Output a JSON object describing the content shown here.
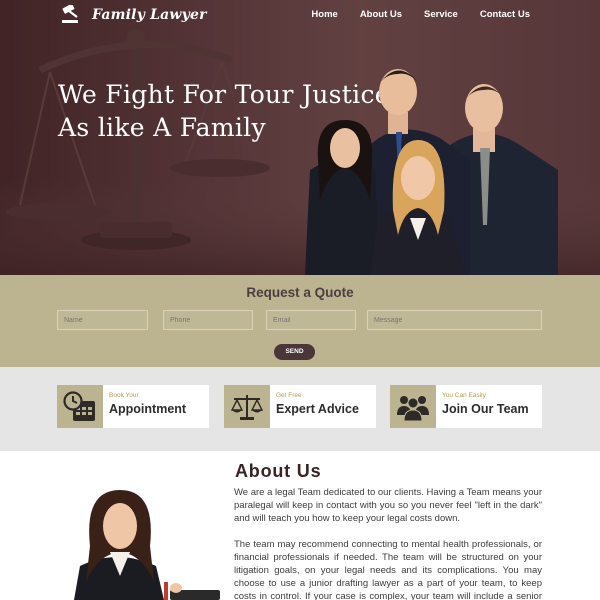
{
  "brand": {
    "name": "Family Lawyer"
  },
  "nav": {
    "items": [
      {
        "label": "Home"
      },
      {
        "label": "About Us"
      },
      {
        "label": "Service"
      },
      {
        "label": "Contact Us"
      }
    ]
  },
  "hero": {
    "line1": "We Fight For Tour Justice",
    "line2": "As like A Family"
  },
  "quote": {
    "title": "Request a Quote",
    "name_placeholder": "Name",
    "phone_placeholder": "Phone",
    "email_placeholder": "Email",
    "message_placeholder": "Message",
    "send_label": "SEND"
  },
  "services": [
    {
      "small": "Book Your",
      "big": "Appointment",
      "icon": "calendar-clock-icon"
    },
    {
      "small": "Get Free",
      "big": "Expert Advice",
      "icon": "scales-icon"
    },
    {
      "small": "You Can Easily",
      "big": "Join Our Team",
      "icon": "team-icon"
    }
  ],
  "about": {
    "title": "About  Us",
    "paragraph1": "We are a legal Team dedicated to our clients. Having a Team means your paralegal will keep in contact with you so you never feel \"left in the dark\" and will teach you how to keep your legal costs down.",
    "paragraph2": "The team may recommend connecting to mental health professionals, or financial professionals if needed. The team will be structured on your litigation goals, on your legal needs and its complications. You may choose to use a junior drafting lawyer as a part of your team, to keep costs in control. If your case is complex, your team will include a senior lawyer to handle"
  },
  "colors": {
    "accent": "#bcb491",
    "hero_dark": "#4a2f31",
    "button": "#4a3538",
    "service_label": "#b59a4e"
  }
}
